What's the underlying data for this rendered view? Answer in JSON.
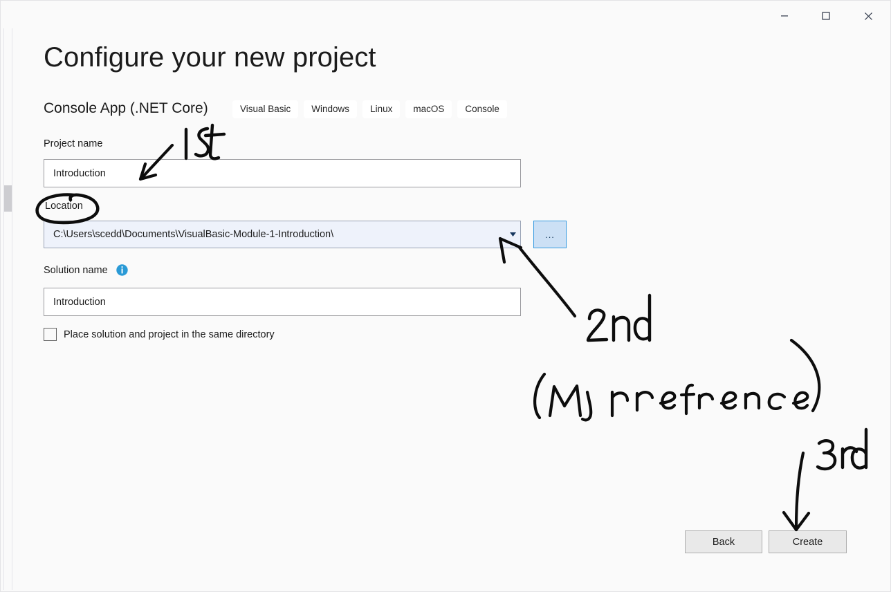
{
  "window": {
    "controls": [
      {
        "name": "minimize",
        "glyph": "minimize-icon"
      },
      {
        "name": "maximize",
        "glyph": "maximize-icon"
      },
      {
        "name": "close",
        "glyph": "close-icon"
      }
    ]
  },
  "header": {
    "title": "Configure your new project",
    "template_name": "Console App (.NET Core)",
    "tags": [
      "Visual Basic",
      "Windows",
      "Linux",
      "macOS",
      "Console"
    ]
  },
  "form": {
    "project_name": {
      "label": "Project name",
      "value": "Introduction"
    },
    "location": {
      "label": "Location",
      "value": "C:\\Users\\scedd\\Documents\\VisualBasic-Module-1-Introduction\\",
      "browse_label": "..."
    },
    "solution_name": {
      "label": "Solution name",
      "value": "Introduction",
      "info_tooltip_icon": "info-icon"
    },
    "same_directory_checkbox": {
      "label": "Place solution and project in the same directory",
      "checked": false
    }
  },
  "footer": {
    "back_label": "Back",
    "create_label": "Create"
  },
  "annotations": {
    "first": "1st",
    "second": "2nd",
    "preference": "(My preference)",
    "third": "3rd",
    "circled_label": "Location",
    "ink_color": "#0d0d0d"
  },
  "colors": {
    "page_background": "#fafafa",
    "accent_blue": "#2a9ad6",
    "combo_background": "#eef2fb",
    "browse_button_fill": "#cce0f5",
    "browse_button_border": "#3399e0",
    "button_fill": "#e9e9e9"
  }
}
